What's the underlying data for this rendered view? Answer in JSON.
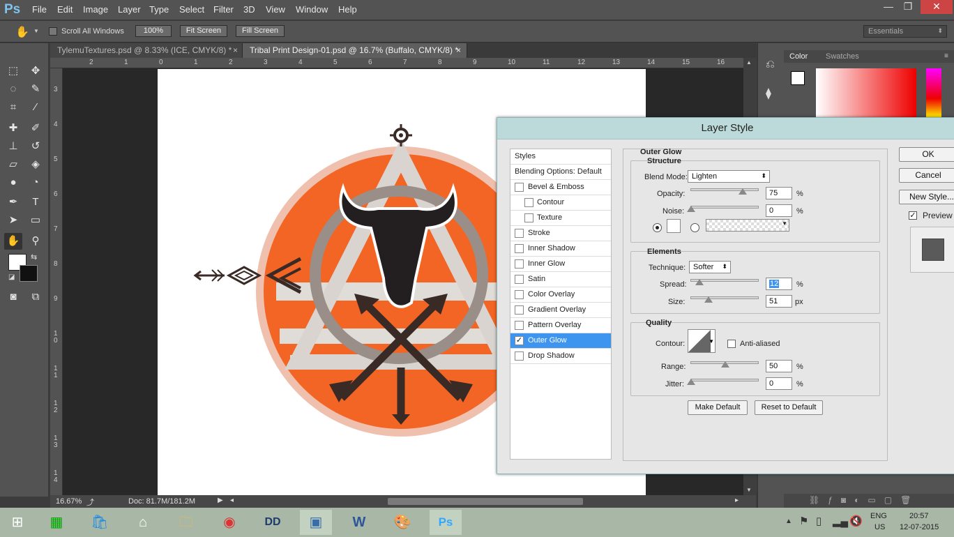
{
  "app": {
    "logo": "Ps",
    "menus": [
      "File",
      "Edit",
      "Image",
      "Layer",
      "Type",
      "Select",
      "Filter",
      "3D",
      "View",
      "Window",
      "Help"
    ],
    "window_buttons": [
      "—",
      "❐",
      "✕"
    ]
  },
  "options": {
    "scroll_all": "Scroll All Windows",
    "zoom_100": "100%",
    "fit_screen": "Fit Screen",
    "fill_screen": "Fill Screen",
    "workspace": "Essentials"
  },
  "tabs": [
    {
      "label": "TylemuTextures.psd @ 8.33% (ICE, CMYK/8) *"
    },
    {
      "label": "Tribal Print Design-01.psd @ 16.7% (Buffalo, CMYK/8) *"
    }
  ],
  "rulers": {
    "h": [
      "2",
      "1",
      "0",
      "1",
      "2",
      "3",
      "4",
      "5",
      "6",
      "7",
      "8",
      "9",
      "10",
      "11",
      "12",
      "13",
      "14",
      "15",
      "16"
    ],
    "v": [
      "3",
      "4",
      "5",
      "6",
      "7",
      "8",
      "9",
      "1 0",
      "1 1",
      "1 2",
      "1 3",
      "1 4"
    ]
  },
  "status": {
    "zoom": "16.67%",
    "doc": "Doc: 81.7M/181.2M"
  },
  "panel": {
    "tab_color": "Color",
    "tab_swatches": "Swatches"
  },
  "dialog": {
    "title": "Layer Style",
    "styles_header": "Styles",
    "blending": "Blending Options: Default",
    "styles": [
      {
        "label": "Bevel & Emboss",
        "checked": false
      },
      {
        "label": "Contour",
        "checked": false
      },
      {
        "label": "Texture",
        "checked": false
      },
      {
        "label": "Stroke",
        "checked": false
      },
      {
        "label": "Inner Shadow",
        "checked": false
      },
      {
        "label": "Inner Glow",
        "checked": false
      },
      {
        "label": "Satin",
        "checked": false
      },
      {
        "label": "Color Overlay",
        "checked": false
      },
      {
        "label": "Gradient Overlay",
        "checked": false
      },
      {
        "label": "Pattern Overlay",
        "checked": false
      },
      {
        "label": "Outer Glow",
        "checked": true
      },
      {
        "label": "Drop Shadow",
        "checked": false
      }
    ],
    "section": "Outer Glow",
    "structure": {
      "title": "Structure",
      "blend_label": "Blend Mode:",
      "blend_value": "Lighten",
      "opacity_label": "Opacity:",
      "opacity": "75",
      "noise_label": "Noise:",
      "noise": "0",
      "pct": "%"
    },
    "elements": {
      "title": "Elements",
      "technique_label": "Technique:",
      "technique": "Softer",
      "spread_label": "Spread:",
      "spread": "12",
      "size_label": "Size:",
      "size": "51",
      "px": "px"
    },
    "quality": {
      "title": "Quality",
      "contour_label": "Contour:",
      "anti_aliased": "Anti-aliased",
      "range_label": "Range:",
      "range": "50",
      "jitter_label": "Jitter:",
      "jitter": "0"
    },
    "make_default": "Make Default",
    "reset_default": "Reset to Default",
    "ok": "OK",
    "cancel": "Cancel",
    "new_style": "New Style...",
    "preview": "Preview"
  },
  "slider_levels": {
    "opacity": 0.75,
    "noise": 0.0,
    "spread": 0.12,
    "size": 0.25,
    "range": 0.5,
    "jitter": 0.0
  },
  "taskbar": {
    "lang": "ENG",
    "region": "US",
    "time": "20:57",
    "date": "12-07-2015"
  },
  "colors": {
    "orange": "#f26524",
    "accent_blue": "#3d95ef",
    "ps_blue": "#7fc4ee"
  }
}
